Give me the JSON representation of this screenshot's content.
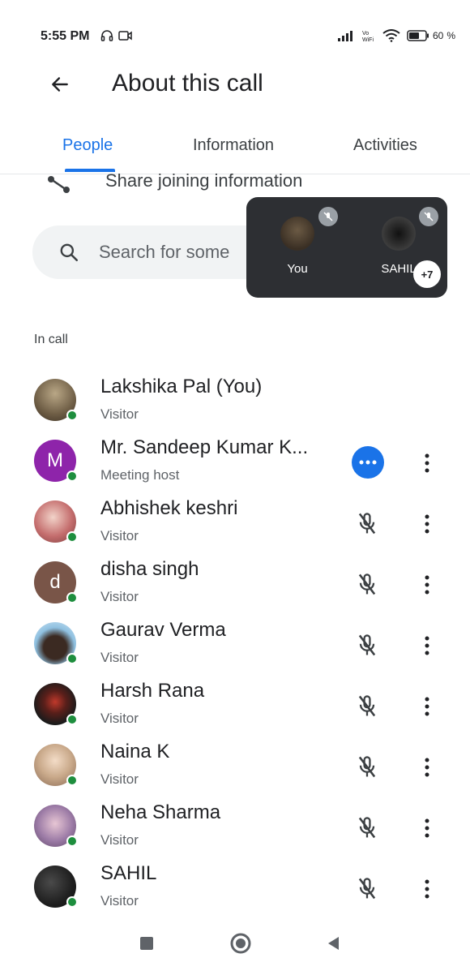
{
  "status_bar": {
    "time": "5:55 PM",
    "battery": "60"
  },
  "app_bar": {
    "title": "About this call"
  },
  "tabs": [
    {
      "label": "People",
      "active": true
    },
    {
      "label": "Information",
      "active": false
    },
    {
      "label": "Activities",
      "active": false
    }
  ],
  "share": {
    "label": "Share joining information"
  },
  "search": {
    "placeholder": "Search for some"
  },
  "pip": {
    "tiles": [
      {
        "name": "You"
      },
      {
        "name": "SAHIL"
      }
    ],
    "more_count": "+7"
  },
  "section": {
    "label": "In call"
  },
  "participants": [
    {
      "name": "Lakshika Pal (You)",
      "role": "Visitor",
      "action": "none",
      "avatar_color": "#8d7a5f"
    },
    {
      "name": "Mr. Sandeep Kumar K...",
      "role": "Meeting host",
      "action": "host",
      "avatar_letter": "M",
      "avatar_color": "#8e24aa"
    },
    {
      "name": "Abhishek keshri",
      "role": "Visitor",
      "action": "mic-off",
      "avatar_color": "#c46d6d"
    },
    {
      "name": "disha singh",
      "role": "Visitor",
      "action": "mic-off",
      "avatar_letter": "d",
      "avatar_color": "#795548"
    },
    {
      "name": "Gaurav Verma",
      "role": "Visitor",
      "action": "mic-off",
      "avatar_color": "#4a6b8a"
    },
    {
      "name": "Harsh Rana",
      "role": "Visitor",
      "action": "mic-off",
      "avatar_color": "#2a2a2a"
    },
    {
      "name": "Naina K",
      "role": "Visitor",
      "action": "mic-off",
      "avatar_color": "#c9a98a"
    },
    {
      "name": "Neha Sharma",
      "role": "Visitor",
      "action": "mic-off",
      "avatar_color": "#9c7ba6"
    },
    {
      "name": "SAHIL",
      "role": "Visitor",
      "action": "mic-off",
      "avatar_color": "#1f1f1f"
    }
  ],
  "colors": {
    "accent": "#1a73e8",
    "online": "#1e8e3e",
    "pip_bg": "#2d2f33"
  }
}
